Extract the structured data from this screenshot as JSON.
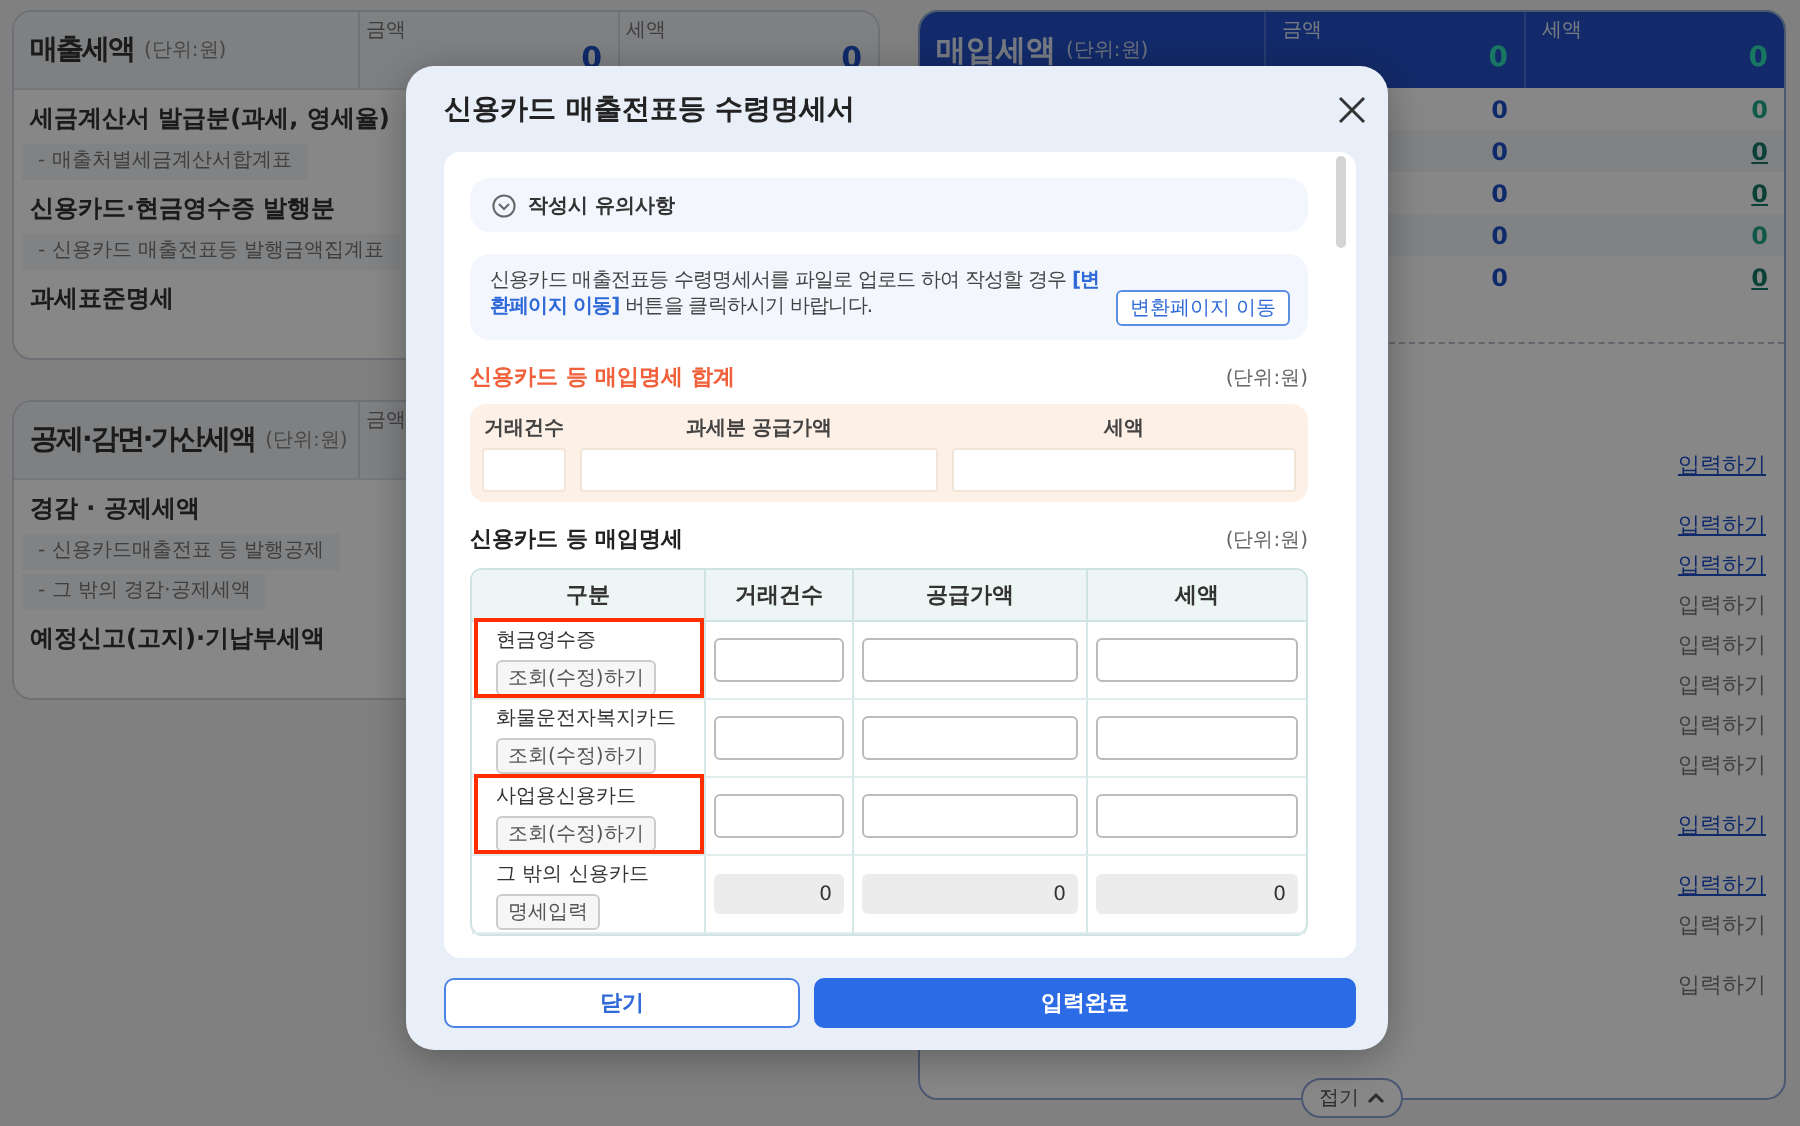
{
  "background": {
    "left_panels": [
      {
        "title": "매출세액",
        "unit": "(단위:원)",
        "columns": [
          "금액",
          "세액"
        ],
        "totals": [
          "0",
          "0"
        ],
        "rows": [
          {
            "kind": "main",
            "label": "세금계산서 발급분(과세, 영세율)"
          },
          {
            "kind": "sub",
            "label": "- 매출처별세금계산서합계표"
          },
          {
            "kind": "main",
            "label": "신용카드·현금영수증 발행분"
          },
          {
            "kind": "sub",
            "label": "- 신용카드 매출전표등 발행금액집계표"
          },
          {
            "kind": "main",
            "label": "과세표준명세"
          }
        ]
      },
      {
        "title": "공제·감면·가산세액",
        "unit": "(단위:원)",
        "columns": [
          "금액"
        ],
        "rows": [
          {
            "kind": "main",
            "label": "경감 · 공제세액"
          },
          {
            "kind": "sub",
            "label": "- 신용카드매출전표 등 발행공제"
          },
          {
            "kind": "sub",
            "label": "- 그 밖의 경감·공제세액"
          },
          {
            "kind": "main",
            "label": "예정신고(고지)·기납부세액"
          }
        ]
      }
    ],
    "right_panel": {
      "title": "매입세액",
      "unit": "(단위:원)",
      "columns": [
        "금액",
        "세액"
      ],
      "totals": [
        "0",
        "0"
      ],
      "value_rows": [
        {
          "amount": "0",
          "tax": "0",
          "tax_linked": false
        },
        {
          "amount": "0",
          "tax": "0",
          "tax_linked": true
        },
        {
          "amount": "0",
          "tax": "0",
          "tax_linked": true
        },
        {
          "amount": "0",
          "tax": "0",
          "tax_linked": false
        },
        {
          "amount": "0",
          "tax": "0",
          "tax_linked": true
        }
      ],
      "link_groups": [
        [
          {
            "label": "입력하기",
            "active": true
          }
        ],
        [
          {
            "label": "입력하기",
            "active": true
          },
          {
            "label": "입력하기",
            "active": true
          },
          {
            "label": "입력하기",
            "active": false
          },
          {
            "label": "입력하기",
            "active": false
          },
          {
            "label": "입력하기",
            "active": false
          },
          {
            "label": "입력하기",
            "active": false
          },
          {
            "label": "입력하기",
            "active": false
          }
        ],
        [
          {
            "label": "입력하기",
            "active": true
          }
        ],
        [
          {
            "label": "입력하기",
            "active": true
          },
          {
            "label": "입력하기",
            "active": false
          }
        ],
        [
          {
            "label": "입력하기",
            "active": false
          }
        ]
      ],
      "collapse_button": "접기"
    }
  },
  "dialog": {
    "title": "신용카드 매출전표등 수령명세서",
    "notes_toggle": {
      "label": "작성시 유의사항",
      "expanded": false
    },
    "notice": {
      "text": "신용카드 매출전표등 수령명세서를 파일로 업로드 하여 작성할 경우 **[변환페이지 이동]** 버튼을 클릭하시기 바랍니다.",
      "button": "변환페이지 이동"
    },
    "summary": {
      "title": "신용카드 등 매입명세 합계",
      "unit": "(단위:원)",
      "field_labels": [
        "거래건수",
        "과세분 공급가액",
        "세액"
      ]
    },
    "details": {
      "title": "신용카드 등 매입명세",
      "unit": "(단위:원)",
      "columns": [
        "구분",
        "거래건수",
        "공급가액",
        "세액"
      ],
      "rows": [
        {
          "label": "현금영수증",
          "button": "조회(수정)하기",
          "kind": "input",
          "highlighted": true
        },
        {
          "label": "화물운전자복지카드",
          "button": "조회(수정)하기",
          "kind": "input",
          "highlighted": false
        },
        {
          "label": "사업용신용카드",
          "button": "조회(수정)하기",
          "kind": "input",
          "highlighted": true
        },
        {
          "label": "그 밖의 신용카드",
          "button": "명세입력",
          "kind": "readonly",
          "values": [
            "0",
            "0",
            "0"
          ],
          "highlighted": false
        }
      ]
    },
    "buttons": [
      {
        "label": "닫기",
        "kind": "secondary"
      },
      {
        "label": "입력완료",
        "kind": "primary"
      }
    ]
  }
}
